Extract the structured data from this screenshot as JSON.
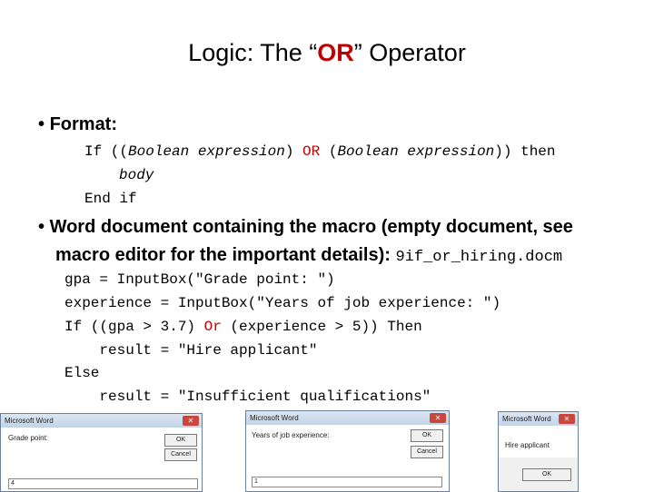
{
  "title": {
    "before": "Logic: The “",
    "highlight": "OR",
    "after": "” Operator"
  },
  "bullet1": {
    "label": "Format:",
    "code": [
      {
        "a": "If ((",
        "b": "Boolean expression",
        "c": ") ",
        "d": "OR",
        "e": " (",
        "f": "Boolean expression",
        "g": ")) then"
      },
      {
        "body": "body"
      },
      {
        "end": "End if"
      }
    ]
  },
  "bullet2": {
    "line1": "Word document containing the macro (empty document, see",
    "line2": "macro editor for the important details): ",
    "filename": "9if_or_hiring.docm"
  },
  "code": [
    "gpa = InputBox(\"Grade point: \")",
    "experience = InputBox(\"Years of job experience: \")",
    {
      "pre": "If ((gpa > 3.7) ",
      "or": "Or",
      "post": " (experience > 5)) Then"
    },
    "    result = \"Hire applicant\"",
    "Else",
    "    result = \"Insufficient qualifications\""
  ],
  "dialogs": [
    {
      "title": "Microsoft Word",
      "prompt": "Grade point:",
      "ok": "OK",
      "cancel": "Cancel",
      "value": "4",
      "close": "✕"
    },
    {
      "title": "Microsoft Word",
      "prompt": "Years of job experience:",
      "ok": "OK",
      "cancel": "Cancel",
      "value": "1",
      "close": "✕"
    },
    {
      "title": "Microsoft Word",
      "message": "Hire applicant",
      "ok": "OK",
      "close": "✕"
    }
  ],
  "colors": {
    "accent": "#c00000"
  }
}
